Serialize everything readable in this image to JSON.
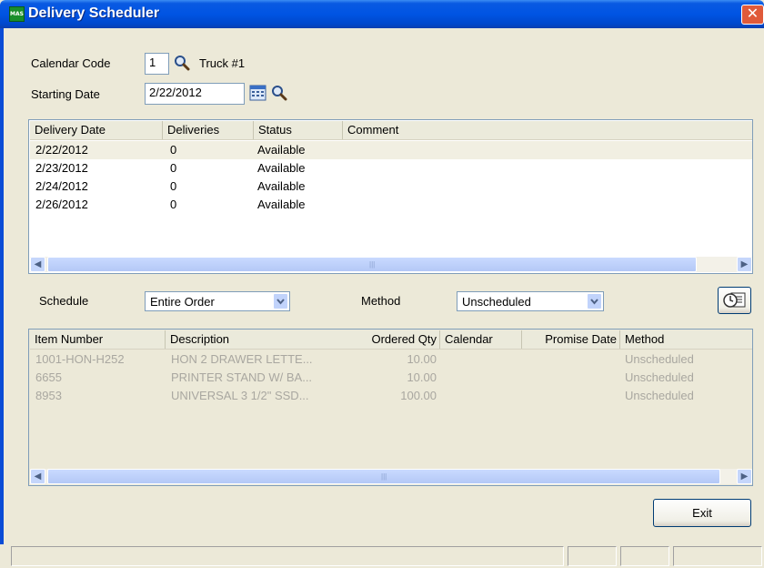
{
  "window": {
    "title": "Delivery Scheduler",
    "app_icon": "MAS",
    "close_label": "✕"
  },
  "calendar": {
    "label": "Calendar Code",
    "value": "1",
    "truck_label": "Truck #1"
  },
  "starting_date": {
    "label": "Starting Date",
    "value": "2/22/2012"
  },
  "calendar_list": {
    "columns": [
      "Delivery Date",
      "Deliveries",
      "Status",
      "Comment"
    ],
    "rows": [
      [
        "2/22/2012",
        "0",
        "Available",
        ""
      ],
      [
        "2/23/2012",
        "0",
        "Available",
        ""
      ],
      [
        "2/24/2012",
        "0",
        "Available",
        ""
      ],
      [
        "2/26/2012",
        "0",
        "Available",
        ""
      ]
    ]
  },
  "schedule": {
    "label": "Schedule",
    "value": "Entire Order"
  },
  "method": {
    "label": "Method",
    "value": "Unscheduled"
  },
  "items_list": {
    "columns": [
      "Item Number",
      "Description",
      "Ordered Qty",
      "Calendar",
      "Promise Date",
      "Method"
    ],
    "rows": [
      [
        "1001-HON-H252",
        "HON 2 DRAWER LETTE...",
        "10.00",
        "",
        "",
        "Unscheduled"
      ],
      [
        "6655",
        "PRINTER STAND W/ BA...",
        "10.00",
        "",
        "",
        "Unscheduled"
      ],
      [
        "8953",
        "UNIVERSAL 3 1/2\" SSD...",
        "100.00",
        "",
        "",
        "Unscheduled"
      ]
    ]
  },
  "buttons": {
    "exit": "Exit"
  },
  "colors": {
    "titlebar": "#0054e3",
    "window_bg": "#ece9d8",
    "close": "#e05a3a"
  },
  "icons": [
    "app-logo-icon",
    "close-icon",
    "magnifier-icon",
    "calendar-icon",
    "clock-calendar-icon",
    "scroll-left-icon",
    "scroll-right-icon",
    "dropdown-arrow-icon"
  ]
}
